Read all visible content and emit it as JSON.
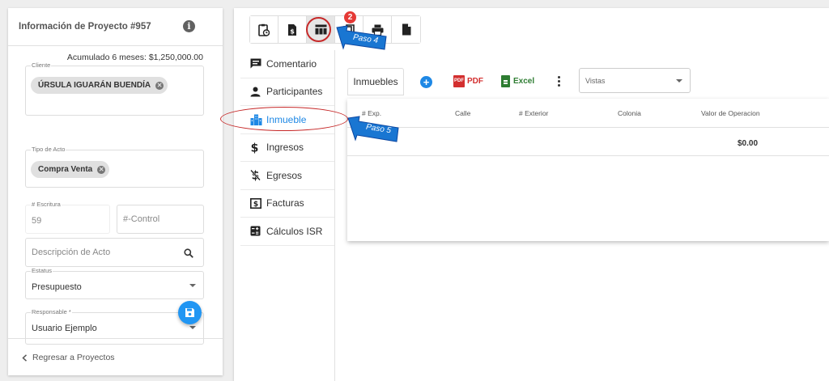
{
  "project": {
    "title": "Información de Proyecto #957",
    "accumulated": "Acumulado 6 meses: $1,250,000.00",
    "cliente_label": "Cliente",
    "cliente_chip": "ÚRSULA IGUARÁN BUENDÍA",
    "tipo_label": "Tipo de Acto",
    "tipo_chip": "Compra Venta",
    "escritura_label": "# Escritura",
    "escritura_value": "59",
    "control_placeholder": "#-Control",
    "descripcion_placeholder": "Descripción de Acto",
    "estatus_label": "Estatus",
    "estatus_value": "Presupuesto",
    "responsable_label": "Responsable *",
    "responsable_value": "Usuario Ejemplo",
    "back_label": "Regresar a Proyectos"
  },
  "toolbar": {
    "icons": [
      "clipboard-clock-icon",
      "invoice-dollar-icon",
      "table-icon",
      "copy-icon",
      "print-icon",
      "document-icon"
    ],
    "badge": "2",
    "active_index": 2
  },
  "menu": {
    "items": [
      {
        "label": "Comentario",
        "icon": "comment-icon"
      },
      {
        "label": "Participantes",
        "icon": "person-icon"
      },
      {
        "label": "Inmueble",
        "icon": "building-icon"
      },
      {
        "label": "Ingresos",
        "icon": "dollar-icon"
      },
      {
        "label": "Egresos",
        "icon": "dollar-off-icon"
      },
      {
        "label": "Facturas",
        "icon": "receipt-dollar-icon"
      },
      {
        "label": "Cálculos ISR",
        "icon": "calculator-icon"
      }
    ],
    "active_index": 2
  },
  "content": {
    "tab_label": "Inmuebles",
    "pdf_label": "PDF",
    "excel_label": "Excel",
    "vistas_placeholder": "Vistas",
    "columns": [
      "# Exp.",
      "Calle",
      "# Exterior",
      "Colonia",
      "Valor de Operacion"
    ],
    "total": "$0.00"
  },
  "callouts": {
    "paso4": "Paso 4",
    "paso5": "Paso 5"
  },
  "colors": {
    "accent": "#1e88e5",
    "callout_blue": "#1976d2",
    "annotation_red": "#c62828",
    "pdf_red": "#d32f2f",
    "excel_green": "#2e7d32"
  }
}
